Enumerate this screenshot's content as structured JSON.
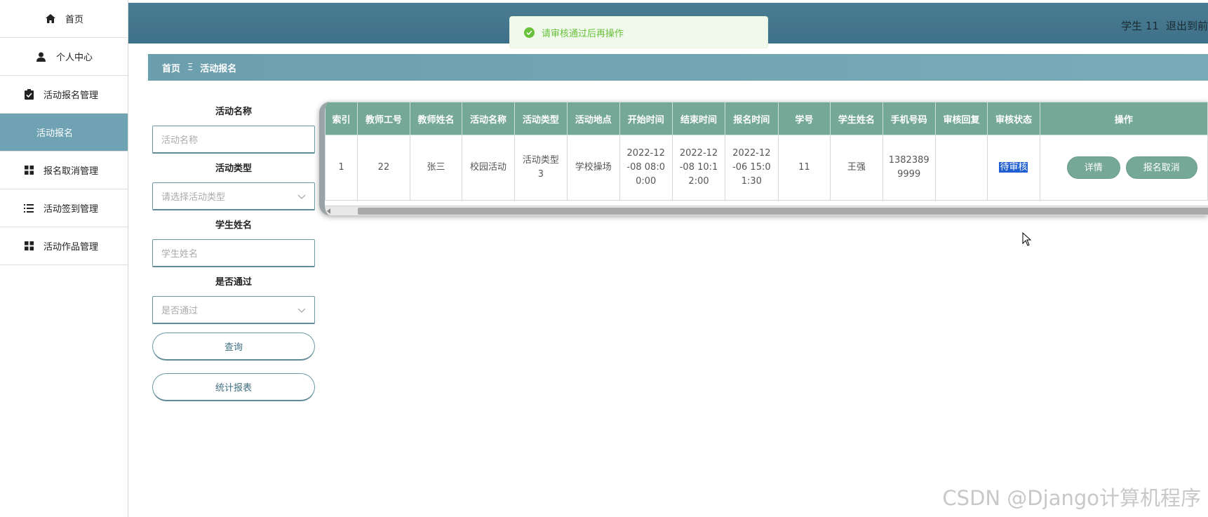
{
  "sidebar": {
    "items": [
      {
        "label": "首页",
        "icon": "home-icon"
      },
      {
        "label": "个人中心",
        "icon": "user-icon"
      },
      {
        "label": "活动报名管理",
        "icon": "clipboard-icon"
      },
      {
        "label": "活动报名",
        "icon": ""
      },
      {
        "label": "报名取消管理",
        "icon": "grid-icon"
      },
      {
        "label": "活动签到管理",
        "icon": "list-icon"
      },
      {
        "label": "活动作品管理",
        "icon": "grid-icon"
      }
    ]
  },
  "header": {
    "user": "学生 11",
    "logout": "退出到前"
  },
  "toast": {
    "message": "请审核通过后再操作"
  },
  "breadcrumb": {
    "home": "首页",
    "sep": "Ξ",
    "current": "活动报名"
  },
  "search": {
    "activity_name_label": "活动名称",
    "activity_name_placeholder": "活动名称",
    "activity_type_label": "活动类型",
    "activity_type_placeholder": "请选择活动类型",
    "student_name_label": "学生姓名",
    "student_name_placeholder": "学生姓名",
    "passed_label": "是否通过",
    "passed_placeholder": "是否通过",
    "query_button": "查询",
    "stats_button": "统计报表"
  },
  "table": {
    "headers": [
      "索引",
      "教师工号",
      "教师姓名",
      "活动名称",
      "活动类型",
      "活动地点",
      "开始时间",
      "结束时间",
      "报名时间",
      "学号",
      "学生姓名",
      "手机号码",
      "审核回复",
      "审核状态",
      "操作"
    ],
    "rows": [
      {
        "index": "1",
        "teacher_id": "22",
        "teacher_name": "张三",
        "activity_name": "校园活动",
        "activity_type": "活动类型3",
        "location": "学校操场",
        "start_time": "2022-12-08 08:00:00",
        "end_time": "2022-12-08 10:12:00",
        "signup_time": "2022-12-06 15:01:30",
        "student_no": "11",
        "student_name": "王强",
        "phone": "13823899999",
        "review_reply": "",
        "review_status": "待审核",
        "detail_button": "详情",
        "cancel_button": "报名取消"
      }
    ]
  },
  "watermark": "CSDN @Django计算机程序"
}
